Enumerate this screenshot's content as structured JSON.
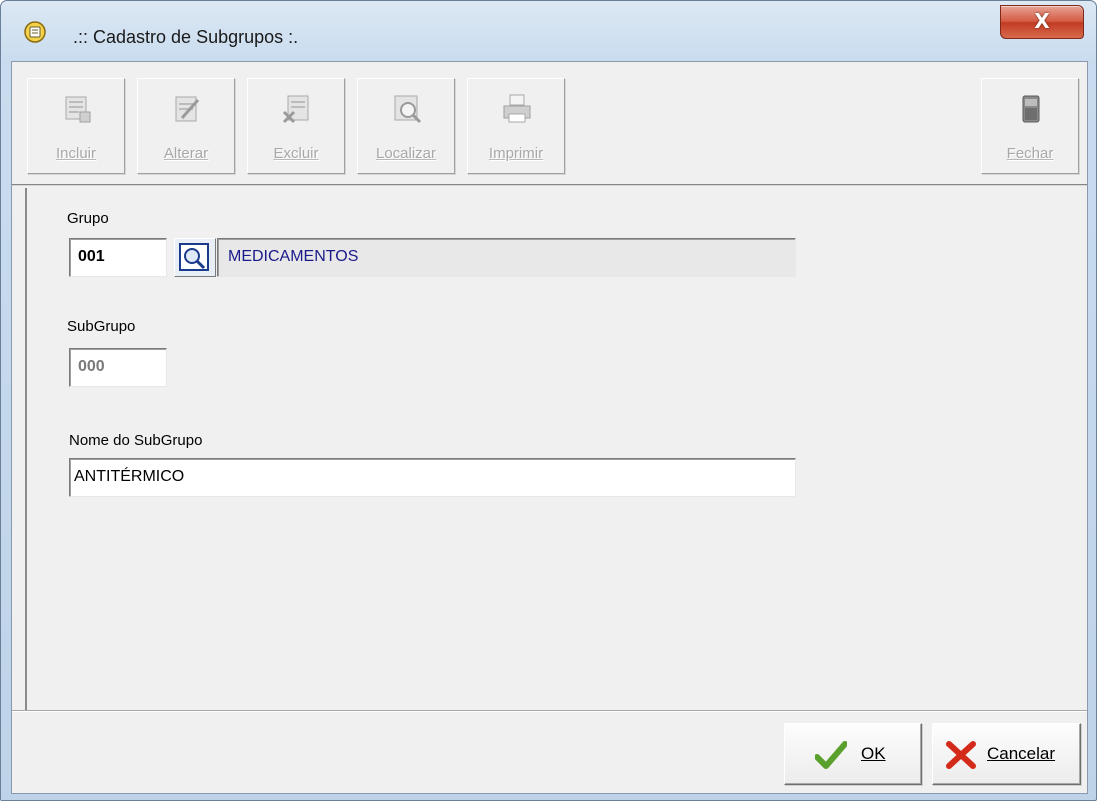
{
  "window": {
    "title": ".:: Cadastro de Subgrupos :.",
    "close_label": "X"
  },
  "toolbar": {
    "buttons": [
      {
        "label": "Incluir",
        "icon": "add-document-icon",
        "enabled": false
      },
      {
        "label": "Alterar",
        "icon": "edit-document-icon",
        "enabled": false
      },
      {
        "label": "Excluir",
        "icon": "delete-document-icon",
        "enabled": false
      },
      {
        "label": "Localizar",
        "icon": "find-document-icon",
        "enabled": false
      },
      {
        "label": "Imprimir",
        "icon": "printer-icon",
        "enabled": false
      },
      {
        "label": "Fechar",
        "icon": "close-door-icon",
        "enabled": false
      }
    ]
  },
  "form": {
    "grupo_label": "Grupo",
    "grupo_code": "001",
    "grupo_name": "MEDICAMENTOS",
    "subgrupo_label": "SubGrupo",
    "subgrupo_code": "000",
    "nome_label": "Nome do SubGrupo",
    "nome_value": "ANTITÉRMICO"
  },
  "actions": {
    "ok_label": "OK",
    "cancel_label": "Cancelar"
  },
  "colors": {
    "ok_check": "#5aa02c",
    "cancel_x": "#d42a1a",
    "readonly_text": "#1a1a8a"
  }
}
